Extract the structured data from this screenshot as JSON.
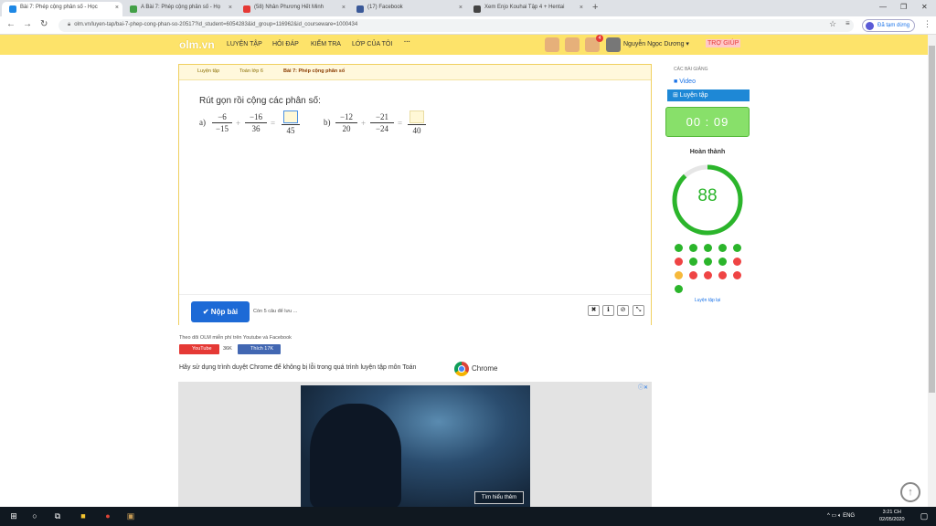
{
  "browser": {
    "tabs": [
      {
        "title": "Bài 7: Phép cộng phân số - Học",
        "active": true,
        "icon_color": "#1e88e5"
      },
      {
        "title": "A Bài 7: Phép cộng phân số - Họ",
        "active": false,
        "icon_color": "#43a047"
      },
      {
        "title": "(58) Nhân Phương Hết Minh",
        "active": false,
        "icon_color": "#e53935"
      },
      {
        "title": "(17) Facebook",
        "active": false,
        "icon_color": "#3b5998"
      },
      {
        "title": "Xem Enjo Kouhai Tập 4 + Hentai",
        "active": false,
        "icon_color": "#444444"
      }
    ],
    "url": "olm.vn/luyen-tap/bai-7-phep-cong-phan-so-20517?id_student=6054283&id_group=116962&id_courseware=1000434",
    "signin_label": "Đã tạm dừng"
  },
  "header": {
    "logo": "olm.vn",
    "nav": [
      "LUYỆN TẬP",
      "HỎI ĐÁP",
      "KIỂM TRA",
      "LỚP CỦA TÔI",
      "···"
    ],
    "notif_count": "4",
    "user_name": "Nguyễn Ngọc Dương ▾",
    "help_label": "TRỢ GIÚP"
  },
  "breadcrumb": [
    "Luyện tập",
    "Toán lớp 6",
    "Bài 7: Phép cộng phân số"
  ],
  "question": {
    "title": "Rút gọn rồi cộng các phân số:",
    "a_label": "a)",
    "a_f1": {
      "num": "−6",
      "den": "−15"
    },
    "a_f2": {
      "num": "−16",
      "den": "36"
    },
    "a_ans_den": "45",
    "b_label": "b)",
    "b_f1": {
      "num": "−12",
      "den": "20"
    },
    "b_f2": {
      "num": "−21",
      "den": "−24"
    },
    "b_ans_den": "40",
    "plus": "+",
    "eq": "="
  },
  "footer": {
    "submit_label": "✔ Nộp bài",
    "remaining": "Còn 5 câu để lưu ..."
  },
  "sidebar": {
    "lessons_header": "CÁC BÀI GIẢNG",
    "video_label": "Video",
    "practice_label": "⊞ Luyện tập",
    "timer": "00 : 09",
    "done_label": "Hoàn thành",
    "score": "88",
    "score_fraction": 0.88,
    "dots": [
      [
        "green",
        "green",
        "green",
        "green",
        "green"
      ],
      [
        "red",
        "green",
        "green",
        "green",
        "red"
      ],
      [
        "orange",
        "red",
        "red",
        "red",
        "red"
      ],
      [
        "green"
      ]
    ],
    "practice_link": "Luyện tập lại"
  },
  "social": {
    "follow_text": "Theo dõi OLM miễn phí trên Youtube và Facebook",
    "yt_label": "YouTube",
    "yt_count": "36K",
    "fb_label": "Thích 17K"
  },
  "chrome_msg": "Hãy sử dụng trình duyệt Chrome để không bị lỗi trong quá trình luyện tập môn Toán",
  "chrome_word": "Chrome",
  "ad": {
    "button_label": "Tìm hiểu thêm"
  },
  "taskbar": {
    "lang": "ENG",
    "time": "3:21 CH",
    "date": "02/05/2020"
  },
  "colors": {
    "accent_yellow": "#fde36a",
    "green": "#2bb52b",
    "red": "#ef4444",
    "orange": "#f6b93b",
    "blue": "#1d6ad6"
  }
}
